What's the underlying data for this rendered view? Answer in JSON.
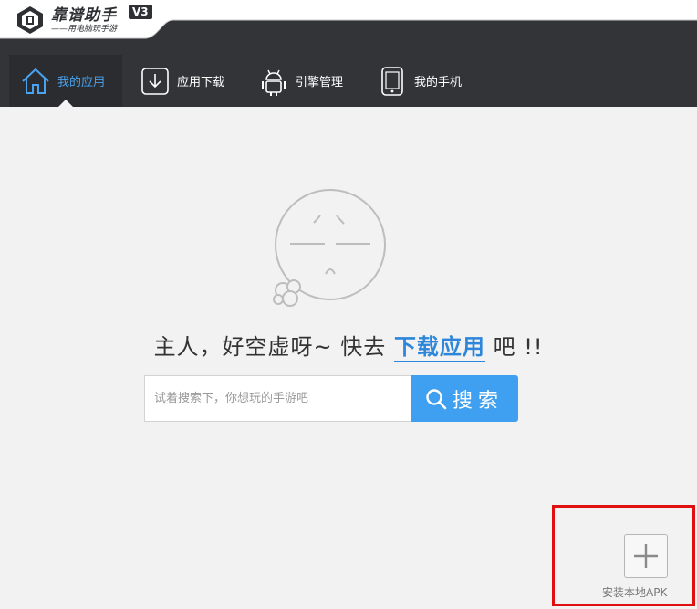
{
  "app": {
    "title": "靠谱助手",
    "subtitle": "——用电脑玩手游",
    "version": "V3"
  },
  "nav": {
    "items": [
      {
        "label": "我的应用",
        "icon": "home-icon",
        "active": true
      },
      {
        "label": "应用下载",
        "icon": "download-icon",
        "active": false
      },
      {
        "label": "引擎管理",
        "icon": "android-icon",
        "active": false
      },
      {
        "label": "我的手机",
        "icon": "phone-icon",
        "active": false
      }
    ]
  },
  "empty": {
    "prefix": "主人，好空虚呀~ 快去 ",
    "link": "下载应用",
    "suffix": " 吧 !!"
  },
  "search": {
    "placeholder": "试着搜索下，你想玩的手游吧",
    "value": "",
    "button_label": "搜索"
  },
  "install": {
    "label": "安装本地APK"
  },
  "colors": {
    "header_bg": "#323438",
    "accent": "#3f9ff0",
    "link": "#2d86d9",
    "highlight": "#e01010"
  }
}
